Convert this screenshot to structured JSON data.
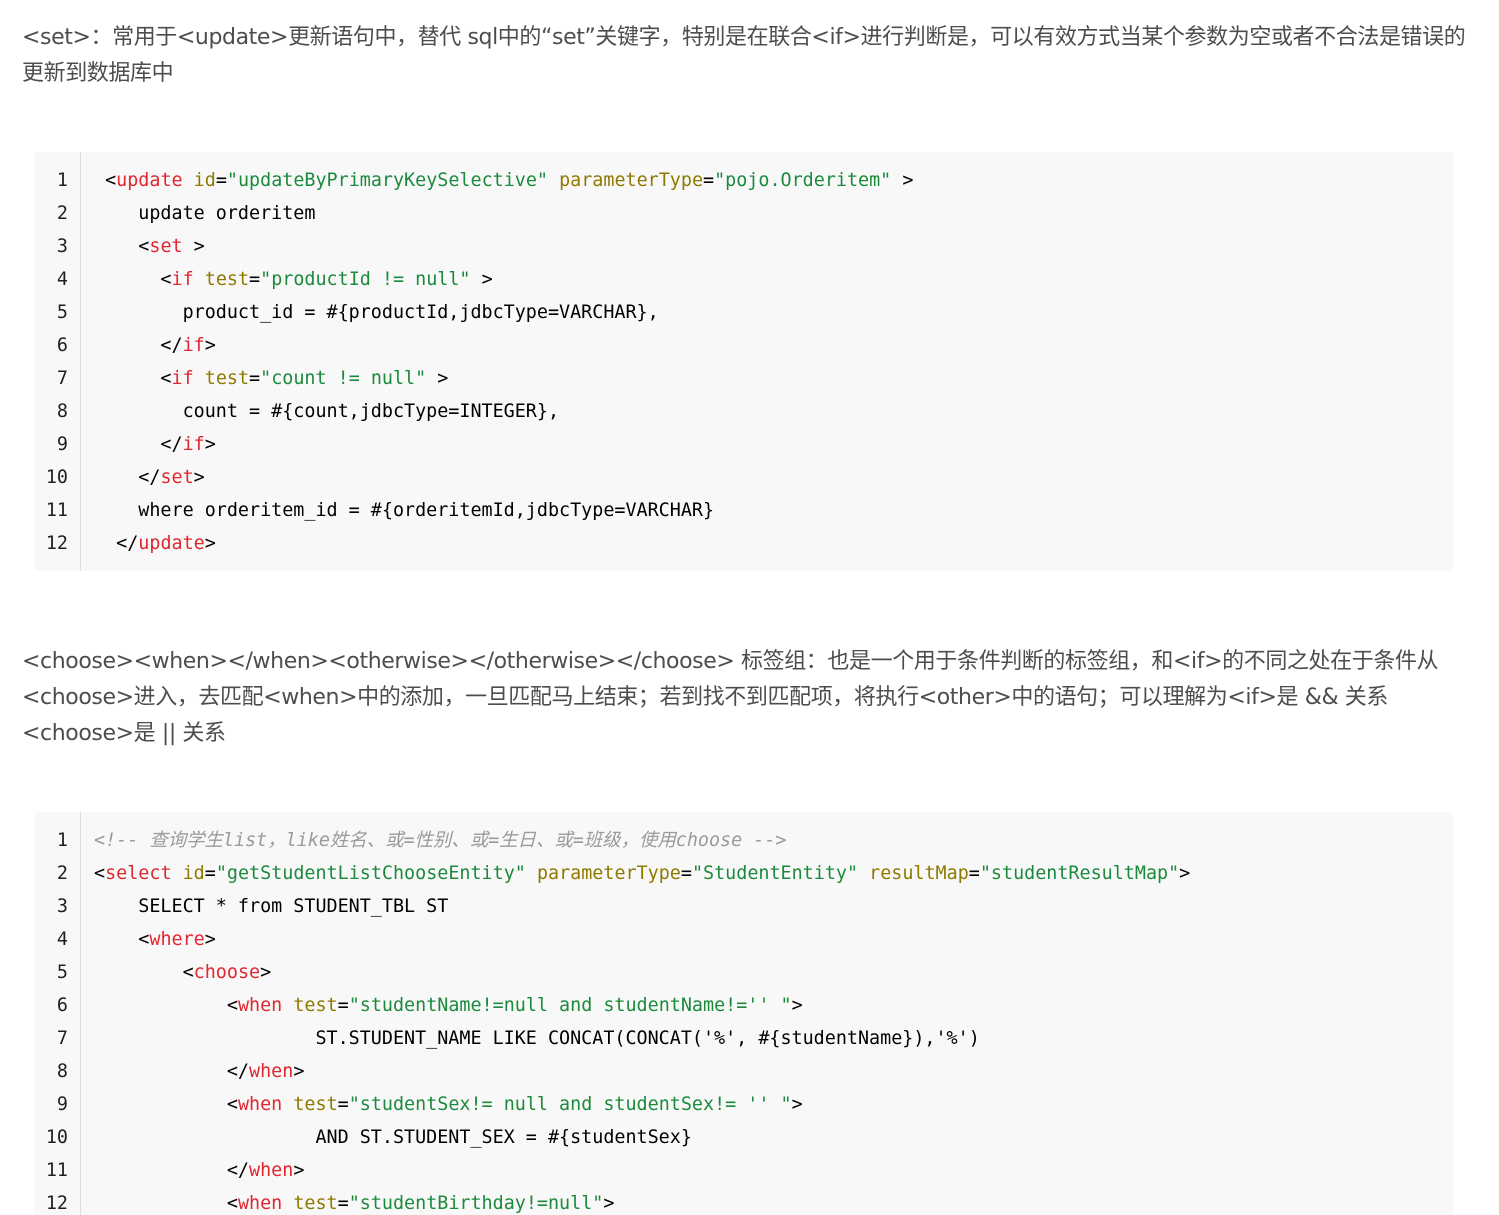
{
  "paragraphs": {
    "p1": "<set>：常用于<update>更新语句中，替代 sql中的“set”关键字，特别是在联合<if>进行判断是，可以有效方式当某个参数为空或者不合法是错误的更新到数据库中",
    "p2": "<choose><when></when><otherwise></otherwise></choose> 标签组：也是一个用于条件判断的标签组，和<if>的不同之处在于条件从<choose>进入，去匹配<when>中的添加，一旦匹配马上结束；若到找不到匹配项，将执行<other>中的语句；可以理解为<if>是 && 关系 <choose>是 || 关系"
  },
  "code_blocks": [
    {
      "lines": [
        {
          "num": "1",
          "tokens": [
            [
              "plain",
              " <"
            ],
            [
              "tag",
              "update"
            ],
            [
              "plain",
              " "
            ],
            [
              "attr",
              "id"
            ],
            [
              "plain",
              "="
            ],
            [
              "str",
              "\"updateByPrimaryKeySelective\""
            ],
            [
              "plain",
              " "
            ],
            [
              "attr",
              "parameterType"
            ],
            [
              "plain",
              "="
            ],
            [
              "str",
              "\"pojo.Orderitem\""
            ],
            [
              "plain",
              " >"
            ]
          ]
        },
        {
          "num": "2",
          "tokens": [
            [
              "plain",
              "    update orderitem"
            ]
          ]
        },
        {
          "num": "3",
          "tokens": [
            [
              "plain",
              "    <"
            ],
            [
              "tag",
              "set"
            ],
            [
              "plain",
              " >"
            ]
          ]
        },
        {
          "num": "4",
          "tokens": [
            [
              "plain",
              "      <"
            ],
            [
              "tag",
              "if"
            ],
            [
              "plain",
              " "
            ],
            [
              "attr",
              "test"
            ],
            [
              "plain",
              "="
            ],
            [
              "str",
              "\"productId != null\""
            ],
            [
              "plain",
              " >"
            ]
          ]
        },
        {
          "num": "5",
          "tokens": [
            [
              "plain",
              "        product_id = #{productId,jdbcType=VARCHAR},"
            ]
          ]
        },
        {
          "num": "6",
          "tokens": [
            [
              "plain",
              "      </"
            ],
            [
              "tag",
              "if"
            ],
            [
              "plain",
              ">"
            ]
          ]
        },
        {
          "num": "7",
          "tokens": [
            [
              "plain",
              "      <"
            ],
            [
              "tag",
              "if"
            ],
            [
              "plain",
              " "
            ],
            [
              "attr",
              "test"
            ],
            [
              "plain",
              "="
            ],
            [
              "str",
              "\"count != null\""
            ],
            [
              "plain",
              " >"
            ]
          ]
        },
        {
          "num": "8",
          "tokens": [
            [
              "plain",
              "        count = #{count,jdbcType=INTEGER},"
            ]
          ]
        },
        {
          "num": "9",
          "tokens": [
            [
              "plain",
              "      </"
            ],
            [
              "tag",
              "if"
            ],
            [
              "plain",
              ">"
            ]
          ]
        },
        {
          "num": "10",
          "tokens": [
            [
              "plain",
              "    </"
            ],
            [
              "tag",
              "set"
            ],
            [
              "plain",
              ">"
            ]
          ]
        },
        {
          "num": "11",
          "tokens": [
            [
              "plain",
              "    where orderitem_id = #{orderitemId,jdbcType=VARCHAR}"
            ]
          ]
        },
        {
          "num": "12",
          "tokens": [
            [
              "plain",
              "  </"
            ],
            [
              "tag",
              "update"
            ],
            [
              "plain",
              ">"
            ]
          ]
        }
      ]
    },
    {
      "lines": [
        {
          "num": "1",
          "tokens": [
            [
              "cmt",
              "<!-- 查询学生list，like姓名、或=性别、或=生日、或=班级，使用choose -->"
            ]
          ]
        },
        {
          "num": "2",
          "tokens": [
            [
              "plain",
              "<"
            ],
            [
              "tag",
              "select"
            ],
            [
              "plain",
              " "
            ],
            [
              "attr",
              "id"
            ],
            [
              "plain",
              "="
            ],
            [
              "str",
              "\"getStudentListChooseEntity\""
            ],
            [
              "plain",
              " "
            ],
            [
              "attr",
              "parameterType"
            ],
            [
              "plain",
              "="
            ],
            [
              "str",
              "\"StudentEntity\""
            ],
            [
              "plain",
              " "
            ],
            [
              "attr",
              "resultMap"
            ],
            [
              "plain",
              "="
            ],
            [
              "str",
              "\"studentResultMap\""
            ],
            [
              "plain",
              ">"
            ]
          ]
        },
        {
          "num": "3",
          "tokens": [
            [
              "plain",
              "    SELECT * from STUDENT_TBL ST"
            ]
          ]
        },
        {
          "num": "4",
          "tokens": [
            [
              "plain",
              "    <"
            ],
            [
              "tag",
              "where"
            ],
            [
              "plain",
              ">"
            ]
          ]
        },
        {
          "num": "5",
          "tokens": [
            [
              "plain",
              "        <"
            ],
            [
              "tag",
              "choose"
            ],
            [
              "plain",
              ">"
            ]
          ]
        },
        {
          "num": "6",
          "tokens": [
            [
              "plain",
              "            <"
            ],
            [
              "tag",
              "when"
            ],
            [
              "plain",
              " "
            ],
            [
              "attr",
              "test"
            ],
            [
              "plain",
              "="
            ],
            [
              "str",
              "\"studentName!=null and studentName!='' \""
            ],
            [
              "plain",
              ">"
            ]
          ]
        },
        {
          "num": "7",
          "tokens": [
            [
              "plain",
              "                    ST.STUDENT_NAME LIKE CONCAT(CONCAT('%', #{studentName}),'%')"
            ]
          ]
        },
        {
          "num": "8",
          "tokens": [
            [
              "plain",
              "            </"
            ],
            [
              "tag",
              "when"
            ],
            [
              "plain",
              ">"
            ]
          ]
        },
        {
          "num": "9",
          "tokens": [
            [
              "plain",
              "            <"
            ],
            [
              "tag",
              "when"
            ],
            [
              "plain",
              " "
            ],
            [
              "attr",
              "test"
            ],
            [
              "plain",
              "="
            ],
            [
              "str",
              "\"studentSex!= null and studentSex!= '' \""
            ],
            [
              "plain",
              ">"
            ]
          ]
        },
        {
          "num": "10",
          "tokens": [
            [
              "plain",
              "                    AND ST.STUDENT_SEX = #{studentSex}"
            ]
          ]
        },
        {
          "num": "11",
          "tokens": [
            [
              "plain",
              "            </"
            ],
            [
              "tag",
              "when"
            ],
            [
              "plain",
              ">"
            ]
          ]
        },
        {
          "num": "12",
          "tokens": [
            [
              "plain",
              "            <"
            ],
            [
              "tag",
              "when"
            ],
            [
              "plain",
              " "
            ],
            [
              "attr",
              "test"
            ],
            [
              "plain",
              "="
            ],
            [
              "str",
              "\"studentBirthday!=null\""
            ],
            [
              "plain",
              ">"
            ]
          ]
        }
      ]
    }
  ]
}
